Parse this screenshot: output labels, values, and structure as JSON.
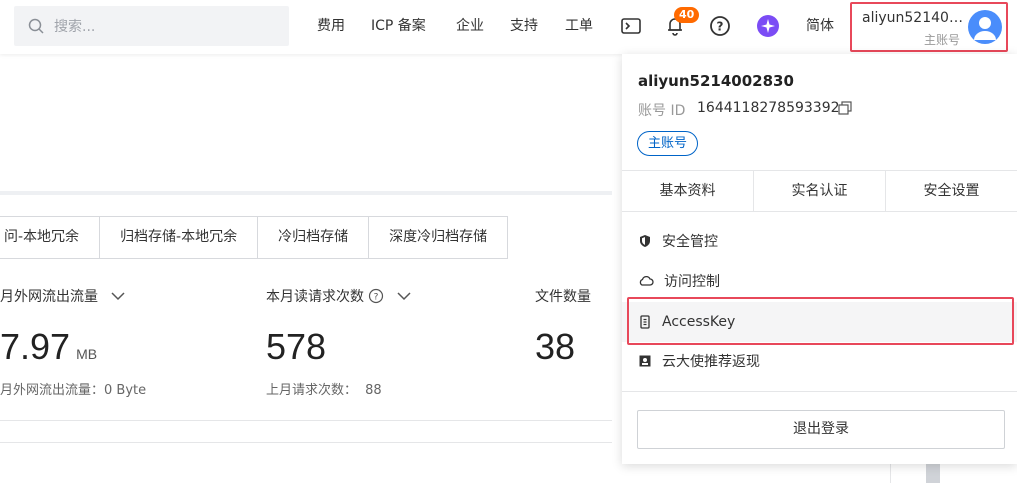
{
  "topbar": {
    "search_placeholder": "搜索...",
    "nav": [
      "费用",
      "ICP 备案",
      "企业",
      "支持",
      "工单"
    ],
    "notification_count": "40",
    "language": "简体",
    "account_name": "aliyun5214002830",
    "account_type": "主账号"
  },
  "storage_tabs": [
    "问-本地冗余",
    "归档存储-本地冗余",
    "冷归档存储",
    "深度冷归档存储"
  ],
  "stats": [
    {
      "label": "月外网流出流量",
      "value": "7.97",
      "unit": "MB",
      "sub": "月外网流出流量：0 Byte"
    },
    {
      "label": "本月读请求次数",
      "value": "578",
      "sub_label": "上月请求次数：",
      "sub_value": "88"
    },
    {
      "label": "文件数量",
      "value": "38"
    }
  ],
  "panel": {
    "name": "aliyun5214002830",
    "id_label": "账号 ID",
    "id_value": "1644118278593392",
    "badge": "主账号",
    "tabs": [
      "基本资料",
      "实名认证",
      "安全设置"
    ],
    "menu": [
      "安全管控",
      "访问控制",
      "AccessKey",
      "云大使推荐返现"
    ],
    "logout": "退出登录"
  },
  "colors": {
    "accent": "#ff6a00",
    "highlight": "#e8485a",
    "link": "#0064c8"
  }
}
